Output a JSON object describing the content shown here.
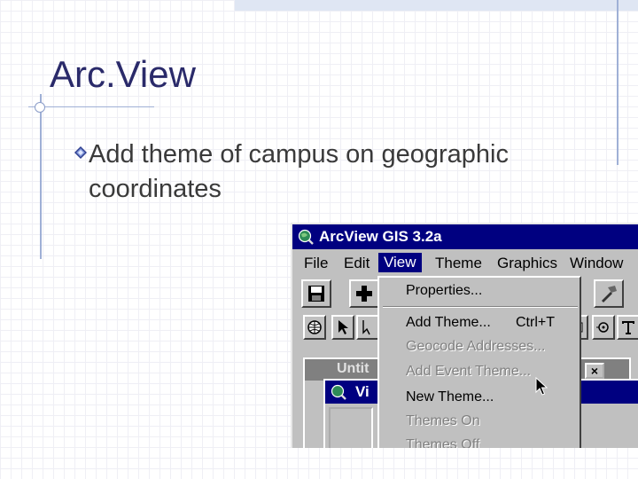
{
  "slide": {
    "title": "Arc.View",
    "bullet": "Add theme of campus on geographic coordinates"
  },
  "app": {
    "title": "ArcView GIS 3.2a",
    "menu": [
      "File",
      "Edit",
      "View",
      "Theme",
      "Graphics",
      "Window"
    ],
    "active_menu": "View",
    "child_window_1_title": "Untit",
    "child_window_2_title": "Vi"
  },
  "dropdown": {
    "properties": "Properties...",
    "add_theme": "Add Theme...",
    "add_theme_shortcut": "Ctrl+T",
    "geocode": "Geocode Addresses...",
    "add_event_theme": "Add Event Theme...",
    "new_theme": "New Theme...",
    "themes_on": "Themes On",
    "themes_off": "Themes Off"
  },
  "colors": {
    "title_bar": "#000080",
    "window_face": "#c0c0c0",
    "slide_title": "#2a2a6a"
  }
}
